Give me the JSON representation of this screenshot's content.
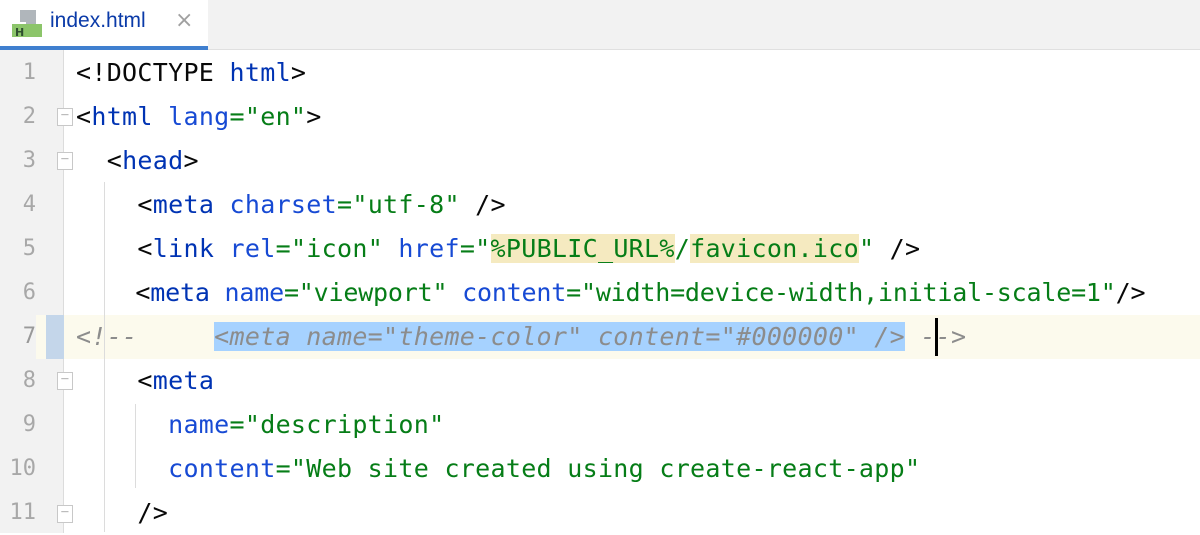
{
  "tab": {
    "label": "index.html",
    "icon": "html-file-icon",
    "close": "×",
    "icon_letter": "H"
  },
  "colors": {
    "tag": "#080808",
    "tag_name": "#0033b3",
    "attr": "#174ad4",
    "value": "#067d17",
    "comment": "#8c8c8c",
    "accent": "#3f7fcf"
  },
  "current_line": 7,
  "lines": [
    {
      "n": "1",
      "tokens": [
        [
          "<!DOCTYPE ",
          "t"
        ],
        [
          "html",
          "n"
        ],
        [
          ">",
          "t"
        ]
      ]
    },
    {
      "n": "2",
      "tokens": [
        [
          "<",
          "t"
        ],
        [
          "html ",
          "n"
        ],
        [
          "lang",
          "a"
        ],
        [
          "=\"en\"",
          "v"
        ],
        [
          ">",
          "t"
        ]
      ]
    },
    {
      "n": "3",
      "tokens": [
        [
          "  <",
          "t"
        ],
        [
          "head",
          "n"
        ],
        [
          ">",
          "t"
        ]
      ]
    },
    {
      "n": "4",
      "tokens": [
        [
          "    <",
          "t"
        ],
        [
          "meta ",
          "n"
        ],
        [
          "charset",
          "a"
        ],
        [
          "=\"utf-8\"",
          "v"
        ],
        [
          " />",
          "t"
        ]
      ]
    },
    {
      "n": "5",
      "tokens": [
        [
          "    <",
          "t"
        ],
        [
          "link ",
          "n"
        ],
        [
          "rel",
          "a"
        ],
        [
          "=\"icon\" ",
          "v"
        ],
        [
          "href",
          "a"
        ],
        [
          "=\"",
          "v"
        ],
        [
          "%PUBLIC_URL%",
          "v hl"
        ],
        [
          "/",
          "v"
        ],
        [
          "favicon.ico",
          "v hl"
        ],
        [
          "\"",
          "v"
        ],
        [
          " />",
          "t"
        ]
      ]
    },
    {
      "n": "6",
      "tokens": [
        [
          "    <",
          "t"
        ],
        [
          "meta ",
          "n"
        ],
        [
          "name",
          "a"
        ],
        [
          "=\"viewport\" ",
          "v"
        ],
        [
          "content",
          "a"
        ],
        [
          "=\"width=device-width,initial-scale=1\"",
          "v"
        ],
        [
          "/>",
          "t"
        ]
      ]
    },
    {
      "n": "7",
      "tokens": [
        [
          "<!--     ",
          "c"
        ],
        [
          "<meta name=\"theme-color\" content=\"#000000\" />",
          "c sel"
        ],
        [
          " -->",
          "c"
        ]
      ]
    },
    {
      "n": "8",
      "tokens": [
        [
          "    <",
          "t"
        ],
        [
          "meta",
          "n"
        ]
      ]
    },
    {
      "n": "9",
      "tokens": [
        [
          "      ",
          "t"
        ],
        [
          "name",
          "a"
        ],
        [
          "=\"description\"",
          "v"
        ]
      ]
    },
    {
      "n": "10",
      "tokens": [
        [
          "      ",
          "t"
        ],
        [
          "content",
          "a"
        ],
        [
          "=\"Web site created using create-react-app\"",
          "v"
        ]
      ]
    },
    {
      "n": "11",
      "tokens": [
        [
          "    />",
          "t"
        ]
      ]
    }
  ]
}
